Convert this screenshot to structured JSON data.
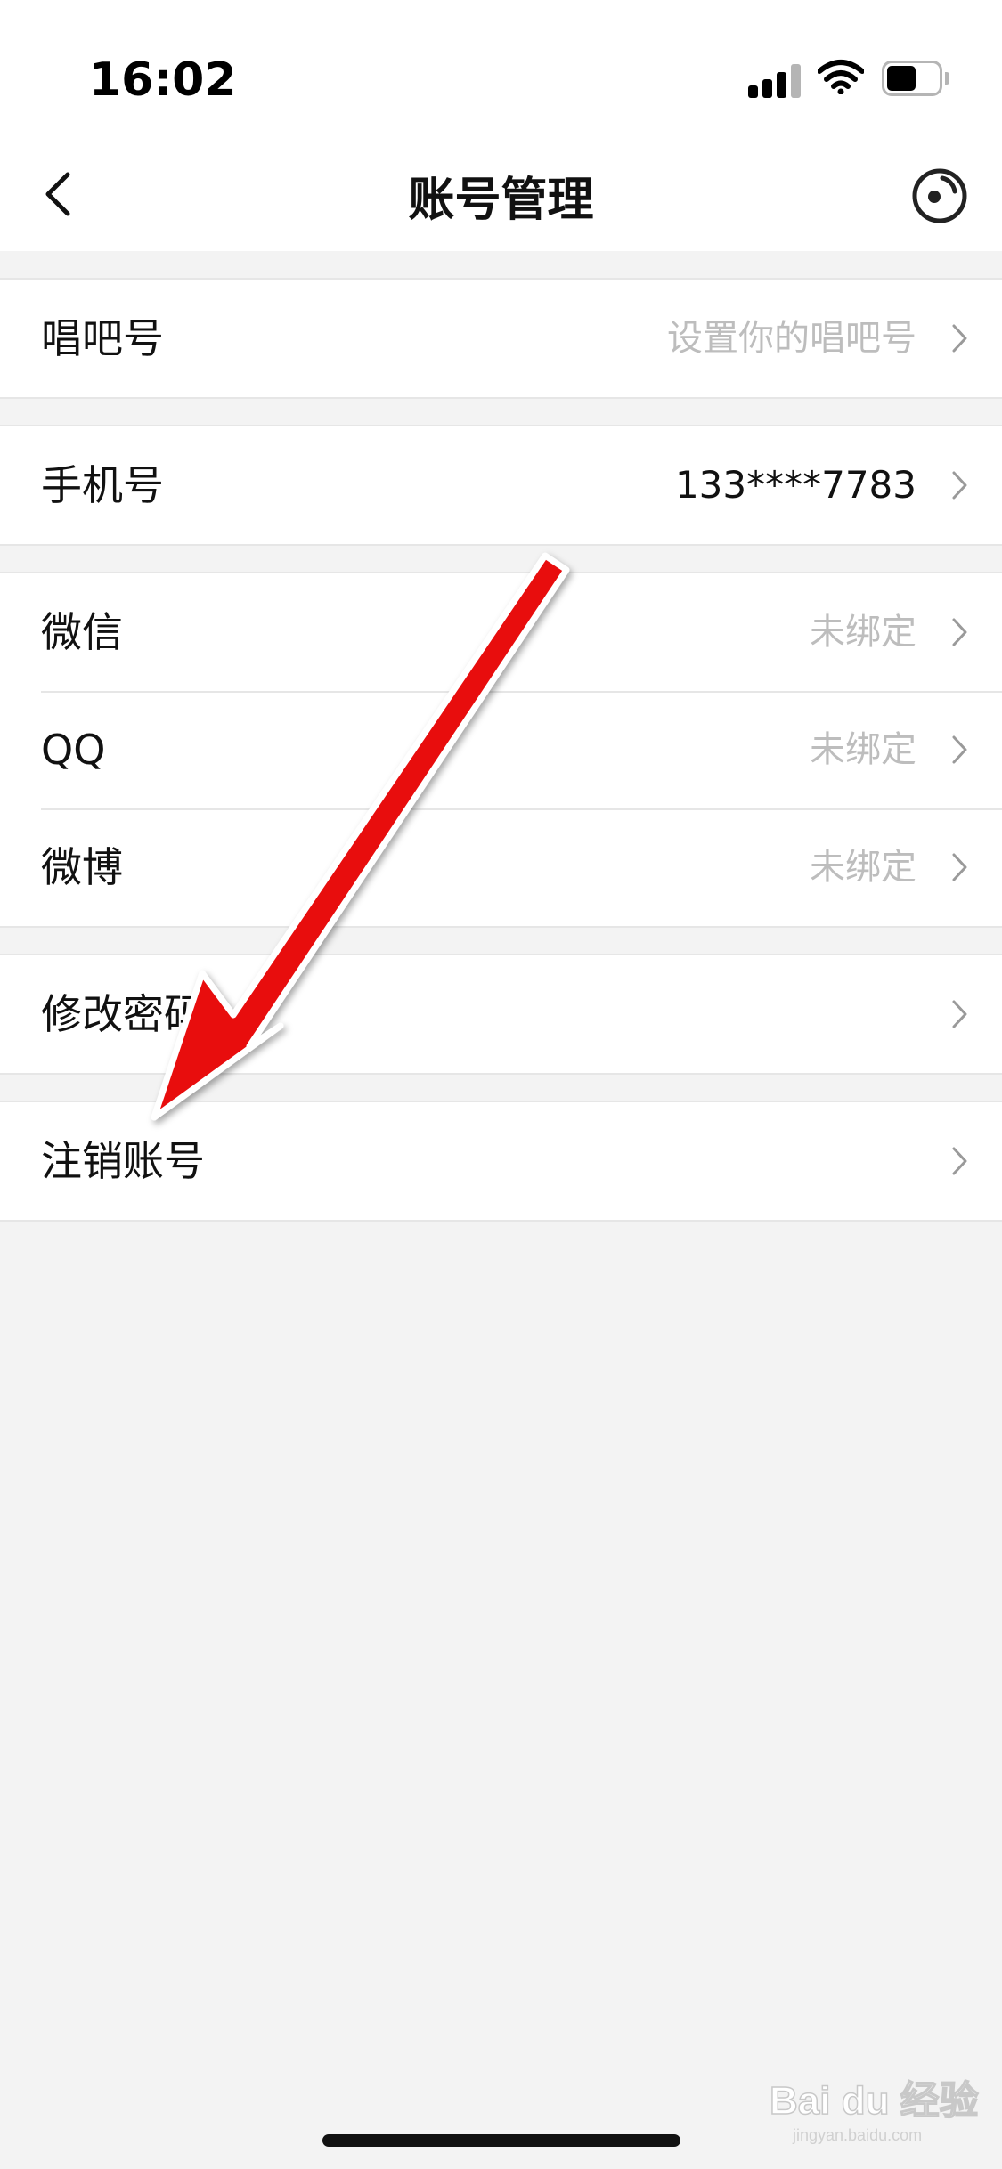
{
  "status_bar": {
    "time": "16:02",
    "icons": [
      "signal-icon",
      "wifi-icon",
      "battery-icon"
    ]
  },
  "nav": {
    "title": "账号管理",
    "back_icon": "chevron-left-icon",
    "right_icon": "target-icon"
  },
  "groups": [
    {
      "rows": [
        {
          "label": "唱吧号",
          "value": "设置你的唱吧号",
          "value_style": "muted"
        }
      ]
    },
    {
      "rows": [
        {
          "label": "手机号",
          "value": "133****7783",
          "value_style": "dark"
        }
      ]
    },
    {
      "rows": [
        {
          "label": "微信",
          "value": "未绑定",
          "value_style": "muted"
        },
        {
          "label": "QQ",
          "value": "未绑定",
          "value_style": "muted"
        },
        {
          "label": "微博",
          "value": "未绑定",
          "value_style": "muted"
        }
      ]
    },
    {
      "rows": [
        {
          "label": "修改密码",
          "value": "",
          "value_style": "muted"
        }
      ]
    },
    {
      "rows": [
        {
          "label": "注销账号",
          "value": "",
          "value_style": "muted"
        }
      ]
    }
  ],
  "colors": {
    "background": "#f3f3f3",
    "surface": "#ffffff",
    "muted_text": "#bdbdbd",
    "annotation_red": "#e8070d"
  },
  "watermark": {
    "brand": "Bai du 经验",
    "url": "jingyan.baidu.com"
  }
}
